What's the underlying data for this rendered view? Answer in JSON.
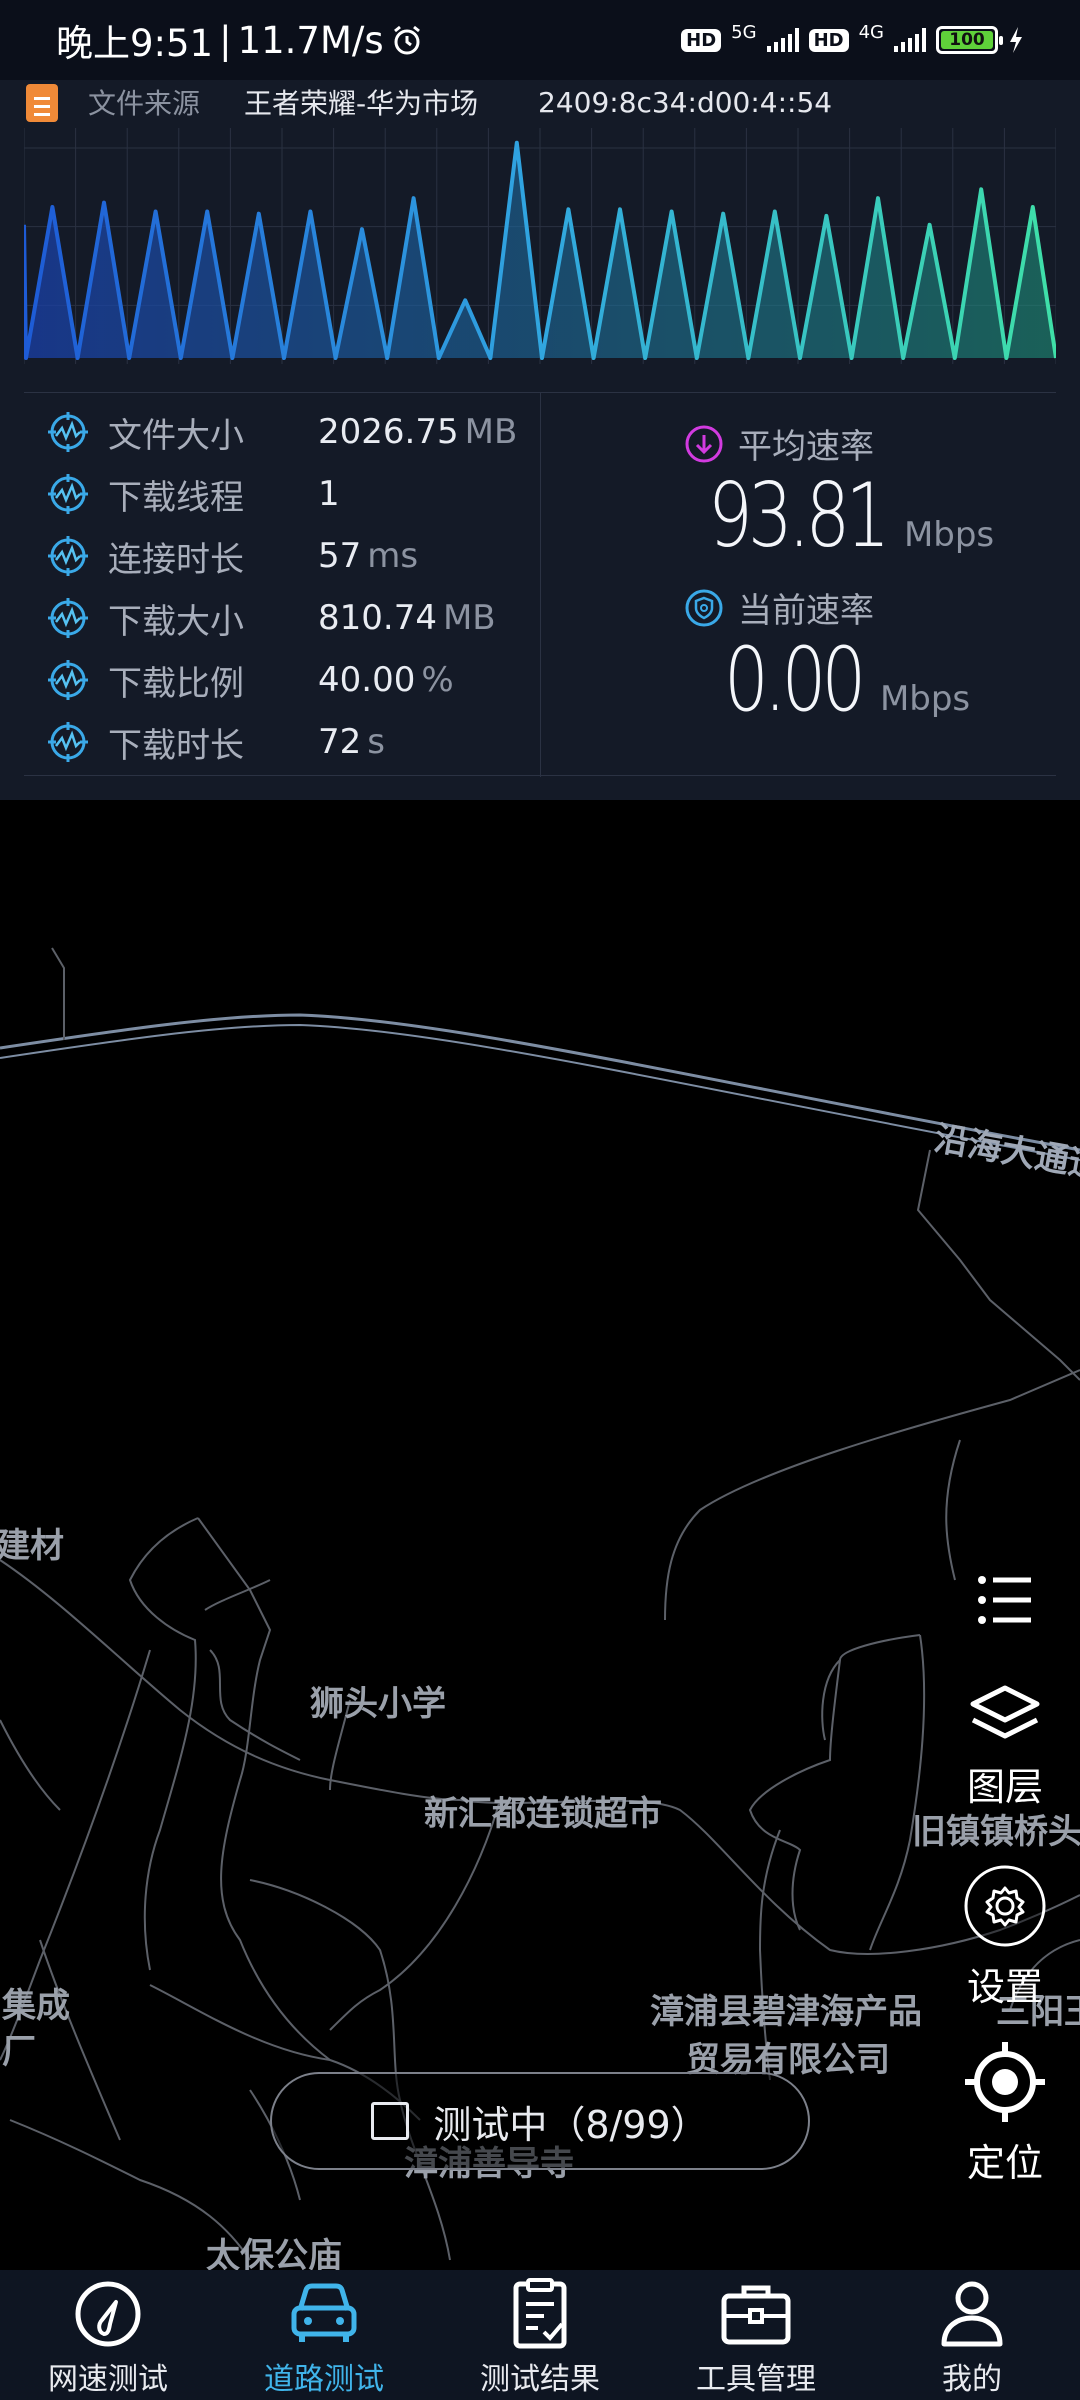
{
  "status_bar": {
    "time": "晚上9:51",
    "speed": "11.7M/s",
    "alarm_icon": "alarm-clock-icon",
    "sim1_type": "5G",
    "sim2_type": "4G",
    "hd_label": "HD",
    "battery": "100"
  },
  "source": {
    "label": "文件来源",
    "name": "王者荣耀-华为市场",
    "ip": "2409:8c34:d00:4::54"
  },
  "speed_chart": {
    "type": "area",
    "title": "",
    "gradient_start": "#1e5bd6",
    "gradient_end": "#3fe0a8",
    "values": [
      0.68,
      0.7,
      0.66,
      0.66,
      0.65,
      0.66,
      0.58,
      0.72,
      0.26,
      0.97,
      0.67,
      0.67,
      0.66,
      0.65,
      0.66,
      0.64,
      0.72,
      0.6,
      0.76,
      0.68
    ],
    "ylim": [
      0,
      1
    ]
  },
  "stats": [
    {
      "label": "文件大小",
      "value": "2026.75",
      "unit": "MB"
    },
    {
      "label": "下载线程",
      "value": "1",
      "unit": ""
    },
    {
      "label": "连接时长",
      "value": "57",
      "unit": "ms"
    },
    {
      "label": "下载大小",
      "value": "810.74",
      "unit": "MB"
    },
    {
      "label": "下载比例",
      "value": "40.00",
      "unit": "%"
    },
    {
      "label": "下载时长",
      "value": "72",
      "unit": "s"
    }
  ],
  "avg_rate": {
    "label": "平均速率",
    "value": "93.81",
    "unit": "Mbps",
    "icon": "download-arrow-icon",
    "color": "#d23be0"
  },
  "cur_rate": {
    "label": "当前速率",
    "value": "0.00",
    "unit": "Mbps",
    "icon": "shield-icon",
    "color": "#3aa9e8"
  },
  "map": {
    "labels": {
      "road": "沿海大通道",
      "materials": "建材",
      "school": "狮头小学",
      "supermarket": "新汇都连锁超市",
      "town_bridge": "旧镇镇桥头",
      "integrated_1": "集成",
      "integrated_2": "厂",
      "company_1": "漳浦县碧津海产品",
      "company_2": "贸易有限公司",
      "sanyang": "三阳王",
      "temple": "漳浦善导寺",
      "taibao": "太保公庙"
    },
    "tools": {
      "list_icon": "list-icon",
      "layers": "图层",
      "settings": "设置",
      "locate": "定位"
    }
  },
  "test_button": {
    "label": "测试中（8/99）"
  },
  "bottom_nav": [
    {
      "label": "网速测试",
      "icon": "speedometer-icon"
    },
    {
      "label": "道路测试",
      "icon": "car-icon",
      "active": true
    },
    {
      "label": "测试结果",
      "icon": "clipboard-check-icon"
    },
    {
      "label": "工具管理",
      "icon": "toolbox-icon"
    },
    {
      "label": "我的",
      "icon": "person-icon"
    }
  ]
}
